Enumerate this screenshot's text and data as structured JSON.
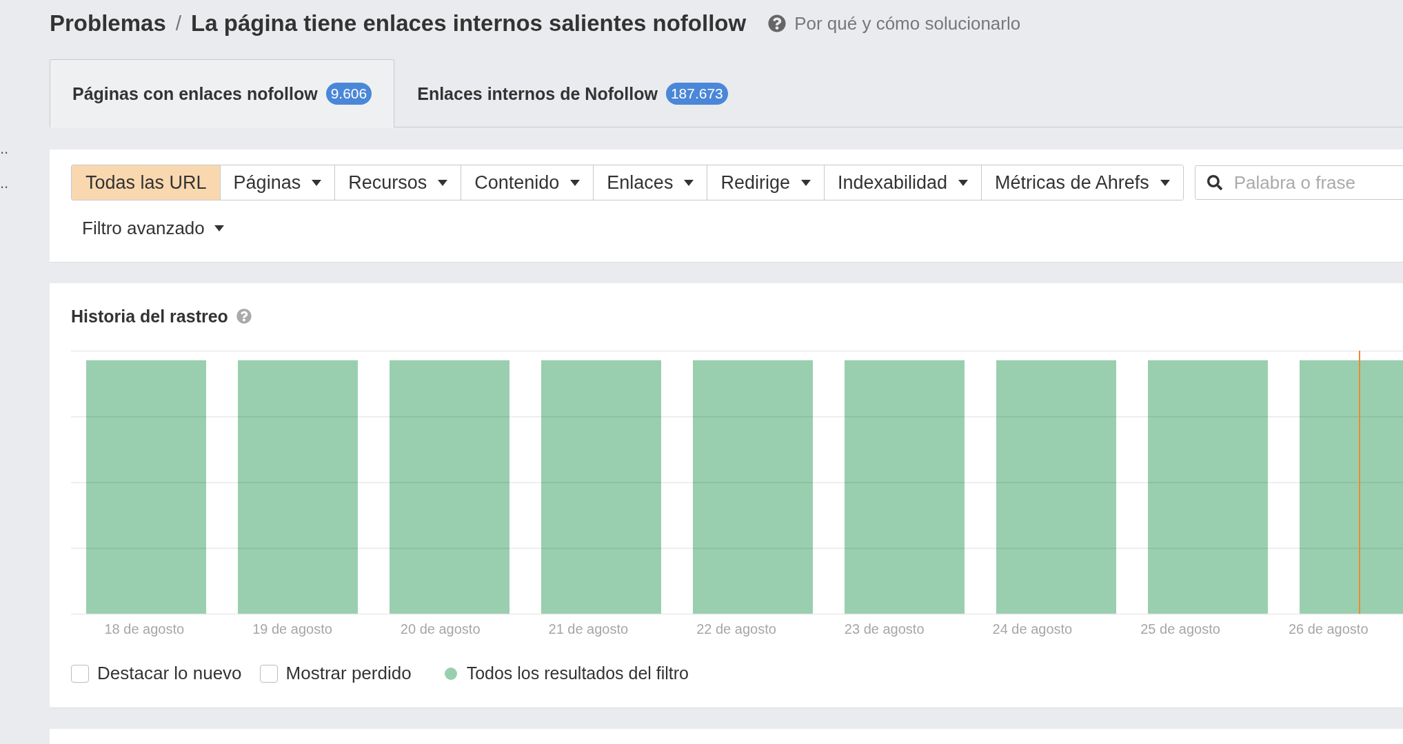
{
  "side_marks": [
    "..",
    ".."
  ],
  "breadcrumb": {
    "parent": "Problemas",
    "separator": "/",
    "current": "La página tiene enlaces internos salientes nofollow"
  },
  "help_link": "Por qué y cómo solucionarlo",
  "tabs": [
    {
      "label": "Páginas con enlaces nofollow",
      "count": "9.606",
      "selected": true
    },
    {
      "label": "Enlaces internos de Nofollow",
      "count": "187.673",
      "selected": false
    }
  ],
  "filters": [
    {
      "label": "Todas las URL",
      "kind": "plain",
      "selected": true
    },
    {
      "label": "Páginas",
      "kind": "dropdown",
      "selected": false
    },
    {
      "label": "Recursos",
      "kind": "dropdown",
      "selected": false
    },
    {
      "label": "Contenido",
      "kind": "dropdown",
      "selected": false
    },
    {
      "label": "Enlaces",
      "kind": "dropdown",
      "selected": false
    },
    {
      "label": "Redirige",
      "kind": "dropdown",
      "selected": false
    },
    {
      "label": "Indexabilidad",
      "kind": "dropdown",
      "selected": false
    },
    {
      "label": "Métricas de Ahrefs",
      "kind": "dropdown",
      "selected": false
    }
  ],
  "search": {
    "placeholder": "Palabra o frase"
  },
  "advanced_filter": "Filtro avanzado",
  "crawl_history": {
    "title": "Historia del rastreo",
    "date_labels": [
      "18 de agosto",
      "19 de agosto",
      "20 de agosto",
      "21 de agosto",
      "22 de agosto",
      "23 de agosto",
      "24 de agosto",
      "25 de agosto",
      "26 de agosto"
    ],
    "options": [
      {
        "label": "Destacar lo nuevo",
        "checked": false
      },
      {
        "label": "Mostrar perdido",
        "checked": false
      }
    ],
    "legend": [
      {
        "label": "Todos los resultados del filtro",
        "color": "#99cfae"
      }
    ]
  }
}
